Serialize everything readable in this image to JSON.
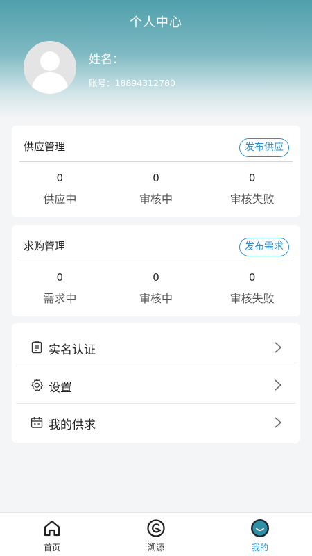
{
  "header": {
    "title": "个人中心",
    "name_label": "姓名：",
    "account_label": "账号：18894312780"
  },
  "supply": {
    "title": "供应管理",
    "action": "发布供应",
    "stats": [
      {
        "value": "0",
        "label": "供应中"
      },
      {
        "value": "0",
        "label": "审核中"
      },
      {
        "value": "0",
        "label": "审核失败"
      }
    ]
  },
  "demand": {
    "title": "求购管理",
    "action": "发布需求",
    "stats": [
      {
        "value": "0",
        "label": "需求中"
      },
      {
        "value": "0",
        "label": "审核中"
      },
      {
        "value": "0",
        "label": "审核失败"
      }
    ]
  },
  "menu": [
    {
      "label": "实名认证",
      "icon": "clipboard-icon"
    },
    {
      "label": "设置",
      "icon": "gear-icon"
    },
    {
      "label": "我的供求",
      "icon": "calendar-icon"
    }
  ],
  "tabbar": [
    {
      "label": "首页",
      "icon": "home-icon",
      "active": false
    },
    {
      "label": "溯源",
      "icon": "trace-icon",
      "active": false
    },
    {
      "label": "我的",
      "icon": "smile-icon",
      "active": true
    }
  ],
  "colors": {
    "accent": "#2a8fd4",
    "header_top": "#4f9fac",
    "background": "#f3f5f6",
    "active_tab_icon": "#2e8fa6"
  }
}
